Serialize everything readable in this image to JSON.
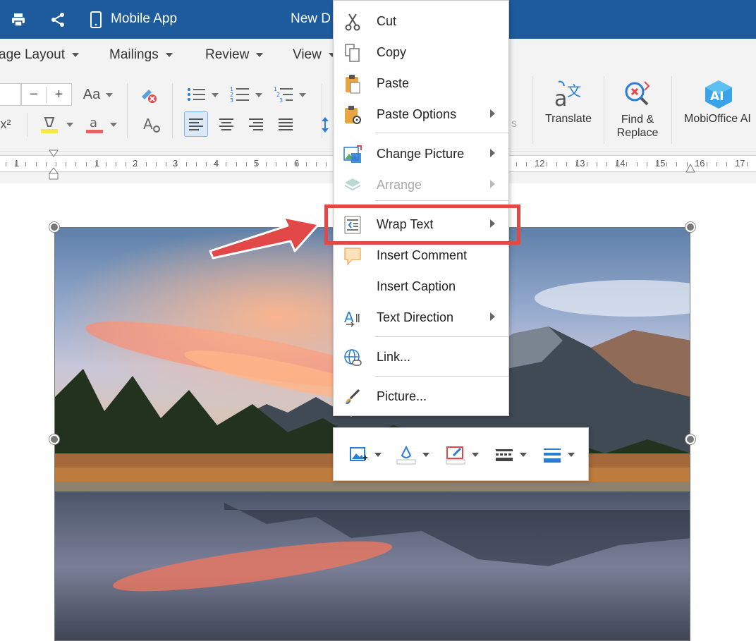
{
  "titlebar": {
    "app_label": "Mobile App",
    "doc_title": "New D"
  },
  "menubar": {
    "items": [
      "age Layout",
      "Mailings",
      "Review",
      "View"
    ]
  },
  "ribbon": {
    "font_case_label": "Aa",
    "superscript_label": "x²",
    "translate_label": "Translate",
    "find_replace_label_1": "Find &",
    "find_replace_label_2": "Replace",
    "ai_label": "MobiOffice AI",
    "ai_badge": "AI",
    "partial_label": "s"
  },
  "ruler": {
    "numbers": [
      "1",
      "1",
      "2",
      "3",
      "4",
      "5",
      "6",
      "12",
      "13",
      "14",
      "15",
      "16",
      "17"
    ]
  },
  "context_menu": {
    "items": [
      {
        "label": "Cut",
        "icon": "scissors-icon",
        "submenu": false,
        "disabled": false
      },
      {
        "label": "Copy",
        "icon": "copy-icon",
        "submenu": false,
        "disabled": false
      },
      {
        "label": "Paste",
        "icon": "paste-icon",
        "submenu": false,
        "disabled": false
      },
      {
        "label": "Paste Options",
        "icon": "paste-options-icon",
        "submenu": true,
        "disabled": false
      },
      {
        "label": "Change Picture",
        "icon": "change-picture-icon",
        "submenu": true,
        "disabled": false
      },
      {
        "label": "Arrange",
        "icon": "arrange-icon",
        "submenu": true,
        "disabled": true
      },
      {
        "label": "Wrap Text",
        "icon": "wrap-text-icon",
        "submenu": true,
        "disabled": false
      },
      {
        "label": "Insert Comment",
        "icon": "comment-icon",
        "submenu": false,
        "disabled": false
      },
      {
        "label": "Insert Caption",
        "icon": "",
        "submenu": false,
        "disabled": false
      },
      {
        "label": "Text Direction",
        "icon": "text-direction-icon",
        "submenu": true,
        "disabled": false
      },
      {
        "label": "Link...",
        "icon": "link-icon",
        "submenu": false,
        "disabled": false
      },
      {
        "label": "Picture...",
        "icon": "picture-format-icon",
        "submenu": false,
        "disabled": false
      }
    ]
  },
  "colors": {
    "titlebar": "#1e5b9c",
    "highlight": "#e34848",
    "accent": "#2b7cd3"
  }
}
